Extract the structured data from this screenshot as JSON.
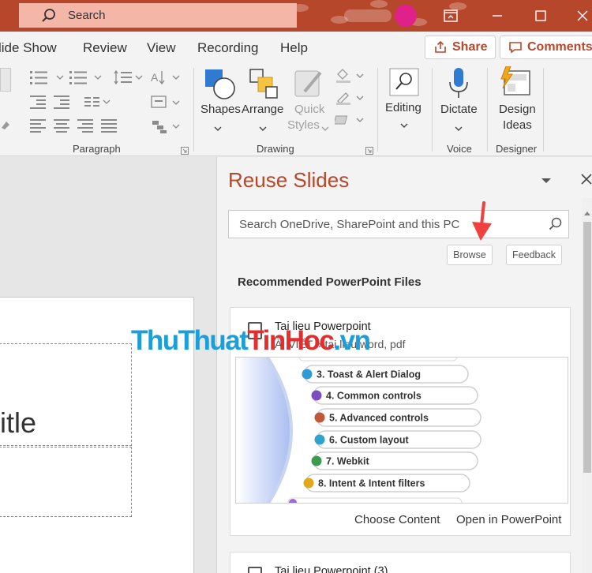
{
  "titlebar": {
    "search_placeholder": "Search",
    "colors": {
      "bar": "#b7472a",
      "search_bg": "#f4b6a6",
      "avatar": "#e0218a"
    }
  },
  "menu": {
    "items": [
      "lide Show",
      "Review",
      "View",
      "Recording",
      "Help"
    ],
    "share": "Share",
    "comments": "Comments"
  },
  "ribbon": {
    "groups": {
      "paragraph": "Paragraph",
      "drawing": "Drawing",
      "voice": "Voice",
      "designer": "Designer"
    },
    "buttons": {
      "shapes": "Shapes",
      "arrange": "Arrange",
      "quick_styles_1": "Quick",
      "quick_styles_2": "Styles",
      "editing": "Editing",
      "dictate": "Dictate",
      "design_1": "Design",
      "design_2": "Ideas"
    }
  },
  "slide": {
    "title_fragment": "itle"
  },
  "pane": {
    "title": "Reuse Slides",
    "search_placeholder": "Search OneDrive, SharePoint and this PC",
    "browse": "Browse",
    "feedback": "Feedback",
    "recommended": "Recommended PowerPoint Files",
    "files": [
      {
        "name": "Tai lieu Powerpoint",
        "path": "ÀI VIẾT » tai lieu word, pdf",
        "choose": "Choose Content",
        "open": "Open in PowerPoint",
        "thumb_items": [
          {
            "label": "3. Toast & Alert Dialog",
            "color": "#2f9bd6"
          },
          {
            "label": "4. Common controls",
            "color": "#7b4fc2"
          },
          {
            "label": "5. Advanced controls",
            "color": "#c0563a"
          },
          {
            "label": "6. Custom layout",
            "color": "#2fa3c9"
          },
          {
            "label": "7. Webkit",
            "color": "#3d9a4f"
          },
          {
            "label": "8. Intent & Intent filters",
            "color": "#e0a81a"
          }
        ]
      },
      {
        "name": "Tai lieu Powerpoint (3)"
      }
    ]
  },
  "watermark": {
    "part1": "ThuThuat",
    "part2": "TinHoc",
    "part3": ".vn"
  }
}
